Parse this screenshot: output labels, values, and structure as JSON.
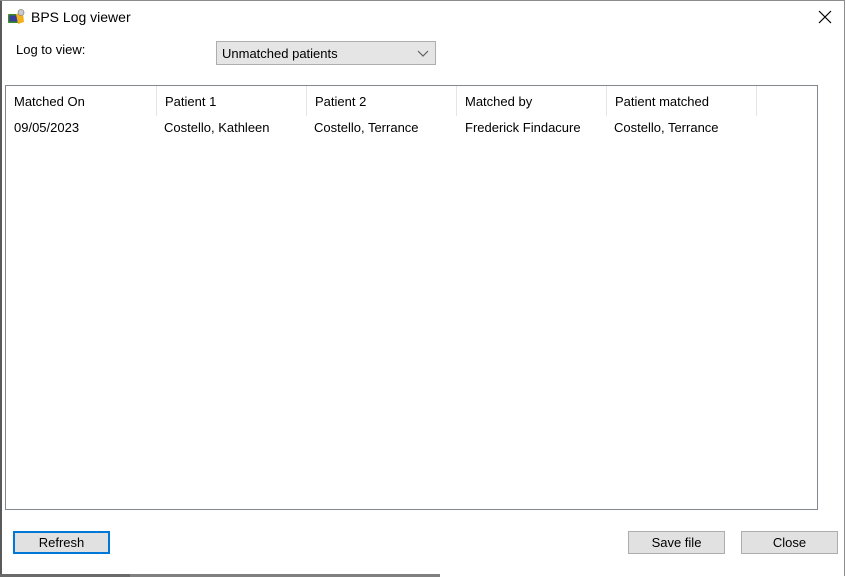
{
  "window": {
    "title": "BPS Log viewer",
    "icon": "bps-app-icon",
    "close_icon": "close-icon"
  },
  "filter": {
    "label": "Log to view:",
    "selected": "Unmatched patients"
  },
  "table": {
    "columns": [
      "Matched On",
      "Patient 1",
      "Patient 2",
      "Matched by",
      "Patient matched"
    ],
    "rows": [
      [
        "09/05/2023",
        "Costello, Kathleen",
        "Costello, Terrance",
        "Frederick Findacure",
        "Costello, Terrance"
      ]
    ]
  },
  "buttons": {
    "refresh": "Refresh",
    "save_file": "Save file",
    "close": "Close"
  }
}
